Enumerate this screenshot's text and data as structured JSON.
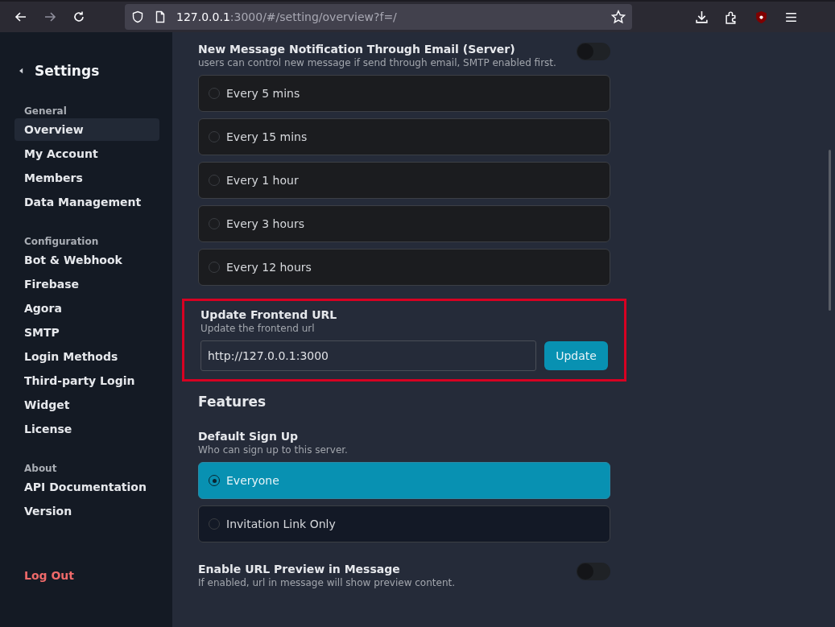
{
  "browser": {
    "url_host": "127.0.0.1",
    "url_rest": ":3000/#/setting/overview?f=/"
  },
  "sidebar": {
    "title": "Settings",
    "groups": [
      {
        "label": "General",
        "items": [
          {
            "label": "Overview",
            "selected": true
          },
          {
            "label": "My Account",
            "selected": false
          },
          {
            "label": "Members",
            "selected": false
          },
          {
            "label": "Data Management",
            "selected": false
          }
        ]
      },
      {
        "label": "Configuration",
        "items": [
          {
            "label": "Bot & Webhook",
            "selected": false
          },
          {
            "label": "Firebase",
            "selected": false
          },
          {
            "label": "Agora",
            "selected": false
          },
          {
            "label": "SMTP",
            "selected": false
          },
          {
            "label": "Login Methods",
            "selected": false
          },
          {
            "label": "Third-party Login",
            "selected": false
          },
          {
            "label": "Widget",
            "selected": false
          },
          {
            "label": "License",
            "selected": false
          }
        ]
      },
      {
        "label": "About",
        "items": [
          {
            "label": "API Documentation",
            "selected": false
          },
          {
            "label": "Version",
            "selected": false
          }
        ]
      }
    ],
    "logout": "Log Out"
  },
  "email_notification": {
    "title": "New Message Notification Through Email (Server)",
    "description": "users can control new message if send through email, SMTP enabled first.",
    "on": false,
    "options": [
      {
        "label": "Every 5 mins",
        "selected": false
      },
      {
        "label": "Every 15 mins",
        "selected": false
      },
      {
        "label": "Every 1 hour",
        "selected": false
      },
      {
        "label": "Every 3 hours",
        "selected": false
      },
      {
        "label": "Every 12 hours",
        "selected": false
      }
    ]
  },
  "frontend_url": {
    "title": "Update Frontend URL",
    "description": "Update the frontend url",
    "value": "http://127.0.0.1:3000",
    "button": "Update",
    "highlighted": true
  },
  "features": {
    "heading": "Features",
    "sign_up": {
      "title": "Default Sign Up",
      "description": "Who can sign up to this server.",
      "options": [
        {
          "label": "Everyone",
          "selected": true
        },
        {
          "label": "Invitation Link Only",
          "selected": false
        }
      ]
    },
    "url_preview": {
      "title": "Enable URL Preview in Message",
      "description": "If enabled, url in message will show preview content.",
      "on": false
    }
  }
}
